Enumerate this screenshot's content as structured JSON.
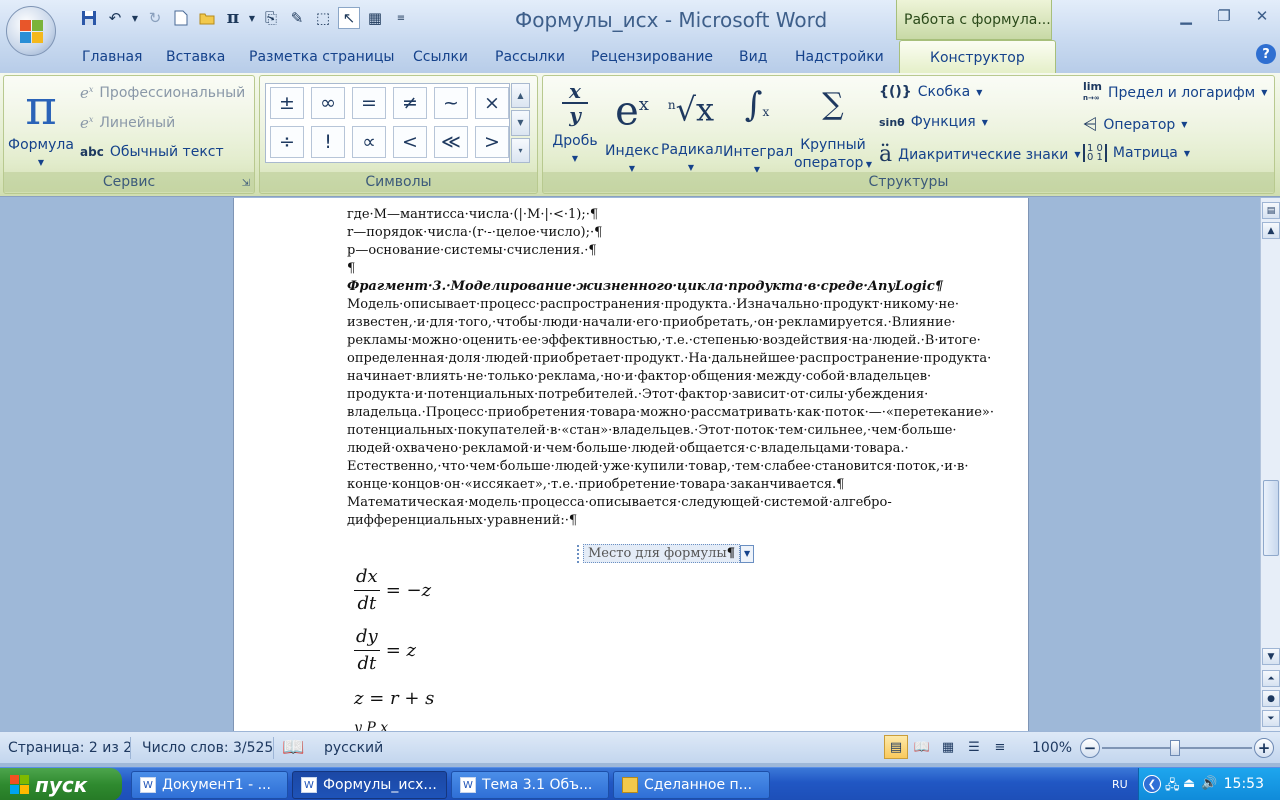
{
  "window": {
    "title": "Формулы_исх - Microsoft Word",
    "contextual_tab_group": "Работа с формула..."
  },
  "quick_access": [
    "save-icon",
    "undo-icon",
    "redo-icon",
    "new-doc-icon",
    "open-icon",
    "pi-icon",
    "attach-icon",
    "brush-icon",
    "select-icon",
    "cursor-icon",
    "picture-select-icon",
    "customize-icon"
  ],
  "tabs": [
    "Главная",
    "Вставка",
    "Разметка страницы",
    "Ссылки",
    "Рассылки",
    "Рецензирование",
    "Вид",
    "Надстройки",
    "Конструктор"
  ],
  "active_tab": "Конструктор",
  "ribbon": {
    "service": {
      "label": "Сервис",
      "formula_btn": "Формула",
      "professional": "Профессиональный",
      "linear": "Линейный",
      "plain_text": "Обычный текст"
    },
    "symbols": {
      "label": "Символы",
      "items": [
        "±",
        "∞",
        "=",
        "≠",
        "~",
        "×",
        "÷",
        "!",
        "∝",
        "<",
        "≪",
        ">"
      ]
    },
    "structures": {
      "label": "Структуры",
      "fraction": "Дробь",
      "index": "Индекс",
      "radical": "Радикал",
      "integral": "Интеграл",
      "large_op_1": "Крупный",
      "large_op_2": "оператор",
      "bracket": "Скобка",
      "function": "Функция",
      "accent": "Диакритические знаки",
      "limit": "Предел и логарифм",
      "operator": "Оператор",
      "matrix": "Матрица"
    }
  },
  "document": {
    "lines": [
      "где·M—мантисса·числа·(|·M·|·<·1);·¶",
      "r—порядок·числа·(r·-·целое·число);·¶",
      "p—основание·системы·счисления.·¶",
      "¶",
      "Фрагмент·3.·Моделирование·жизненного·цикла·продукта·в·среде·AnyLogic¶",
      "Модель·описывает·процесс·распространения·продукта.·Изначально·продукт·никому·не·",
      "известен,·и·для·того,·чтобы·люди·начали·его·приобретать,·он·рекламируется.·Влияние·",
      "рекламы·можно·оценить·ее·эффективностью,·т.е.·степенью·воздействия·на·людей.·В·итоге·",
      "определенная·доля·людей·приобретает·продукт.·На·дальнейшее·распространение·продукта·",
      "начинает·влиять·не·только·реклама,·но·и·фактор·общения·между·собой·владельцев·",
      "продукта·и·потенциальных·потребителей.·Этот·фактор·зависит·от·силы·убеждения·",
      "владельца.·Процесс·приобретения·товара·можно·рассматривать·как·поток·—·«перетекание»·",
      "потенциальных·покупателей·в·«стан»·владельцев.·Этот·поток·тем·сильнее,·чем·больше·",
      "людей·охвачено·рекламой·и·чем·больше·людей·общается·с·владельцами·товара.·",
      "Естественно,·что·чем·больше·людей·уже·купили·товар,·тем·слабее·становится·поток,·и·в·",
      "конце·концов·он·«иссякает»,·т.е.·приобретение·товара·заканчивается.¶",
      "Математическая·модель·процесса·описывается·следующей·системой·алгебро-",
      "дифференциальных·уравнений:·¶"
    ],
    "placeholder": "Место для формулы",
    "pilcrow": "¶",
    "equations": [
      {
        "num": "dx",
        "den": "dt",
        "rhs": "= −z"
      },
      {
        "num": "dy",
        "den": "dt",
        "rhs": "= z"
      },
      {
        "lhs": "z = r + s"
      }
    ]
  },
  "status": {
    "page": "Страница: 2 из 2",
    "words": "Число слов: 3/525",
    "language": "русский",
    "zoom": "100%",
    "zoom_value": 100
  },
  "taskbar": {
    "start": "пуск",
    "tasks": [
      "Документ1 - ...",
      "Формулы_исх...",
      "Тема 3.1 Объ...",
      "Сделанное п..."
    ],
    "lang": "RU",
    "time": "15:53"
  },
  "colors": {
    "accent": "#15428b",
    "contextual": "#c8d9a6",
    "taskbar": "#2157c4",
    "start": "#2f8a2f"
  }
}
